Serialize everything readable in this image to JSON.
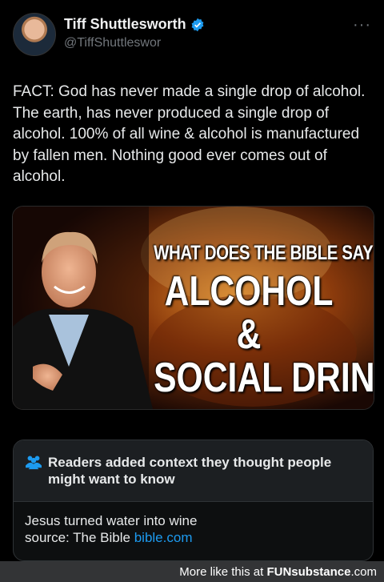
{
  "tweet": {
    "author_name": "Tiff Shuttlesworth",
    "handle": "@TiffShuttleswor",
    "more_icon": "···",
    "text": "FACT: God has never made a single drop of alcohol. The earth, has never produced a single drop of alcohol. 100% of all wine & alcohol is manufactured by fallen men. Nothing good ever comes out of alcohol."
  },
  "media": {
    "line1": "WHAT DOES THE BIBLE SAY ABOUT",
    "line2": "ALCOHOL &",
    "line3": "SOCIAL DRINKING"
  },
  "community_note": {
    "title": "Readers added context they thought people might want to know",
    "body_line1": "Jesus turned water into wine",
    "body_line2_prefix": "source: The Bible ",
    "link": "bible.com"
  },
  "footer": {
    "prefix": "More like this at ",
    "brand": "FUNsubstance",
    "suffix": ".com"
  },
  "colors": {
    "background": "#000000",
    "link": "#1d9bf0",
    "verified": "#1d9bf0",
    "muted": "#71767b"
  }
}
